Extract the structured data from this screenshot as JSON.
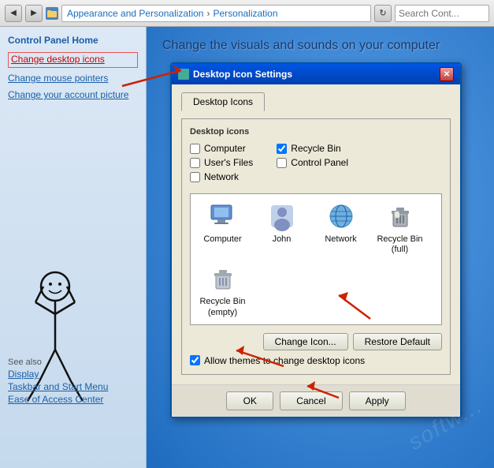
{
  "addressbar": {
    "breadcrumb_part1": "Appearance and Personalization",
    "breadcrumb_sep": "›",
    "breadcrumb_part2": "Personalization",
    "search_placeholder": "Search Cont..."
  },
  "sidebar": {
    "title": "Control Panel Home",
    "links": [
      {
        "id": "change-desktop-icons",
        "label": "Change desktop icons",
        "active": true
      },
      {
        "id": "change-mouse-pointers",
        "label": "Change mouse pointers",
        "active": false
      },
      {
        "id": "change-account-picture",
        "label": "Change your account picture",
        "active": false
      }
    ],
    "see_also_title": "See also",
    "see_also_links": [
      {
        "id": "display",
        "label": "Display"
      },
      {
        "id": "taskbar",
        "label": "Taskbar and Start Menu"
      },
      {
        "id": "ease-of-access",
        "label": "Ease of Access Center"
      }
    ]
  },
  "content": {
    "page_title": "Change the visuals and sounds on your computer"
  },
  "dialog": {
    "title": "Desktop Icon Settings",
    "tab": "Desktop Icons",
    "section_label": "Desktop icons",
    "checkboxes": [
      {
        "id": "computer",
        "label": "Computer",
        "checked": false
      },
      {
        "id": "users-files",
        "label": "User's Files",
        "checked": false
      },
      {
        "id": "network",
        "label": "Network",
        "checked": false
      },
      {
        "id": "recycle-bin",
        "label": "Recycle Bin",
        "checked": true
      },
      {
        "id": "control-panel",
        "label": "Control Panel",
        "checked": false
      }
    ],
    "icons": [
      {
        "id": "computer",
        "label": "Computer",
        "type": "computer"
      },
      {
        "id": "john",
        "label": "John",
        "type": "user"
      },
      {
        "id": "network",
        "label": "Network",
        "type": "network"
      },
      {
        "id": "recycle-full",
        "label": "Recycle Bin\n(full)",
        "type": "recycle-full"
      },
      {
        "id": "recycle-empty",
        "label": "Recycle Bin\n(empty)",
        "type": "recycle-empty"
      }
    ],
    "change_icon_btn": "Change Icon...",
    "restore_default_btn": "Restore Default",
    "allow_themes_label": "Allow themes to change desktop icons",
    "allow_themes_checked": true,
    "ok_btn": "OK",
    "cancel_btn": "Cancel",
    "apply_btn": "Apply"
  }
}
